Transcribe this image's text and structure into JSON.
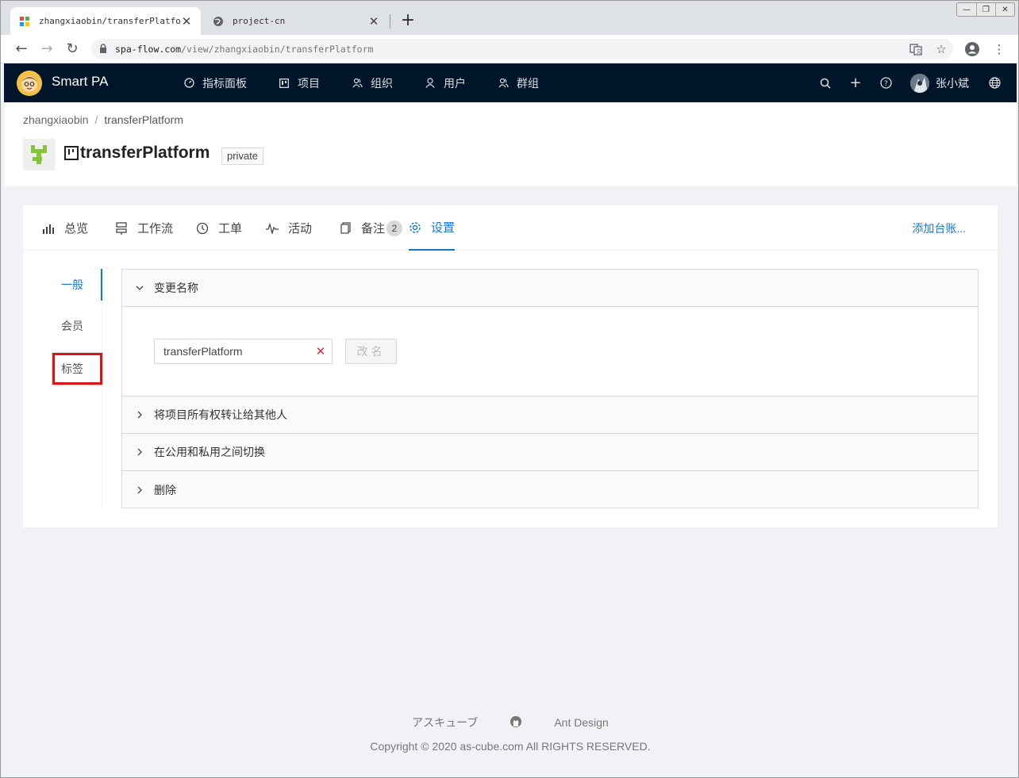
{
  "browser": {
    "tabs": [
      {
        "title": "zhangxiaobin/transferPlatform",
        "active": true
      },
      {
        "title": "project-cn",
        "active": false
      }
    ],
    "url_host": "spa-flow.com",
    "url_path": "/view/zhangxiaobin/transferPlatform"
  },
  "header": {
    "app_name": "Smart PA",
    "nav": [
      {
        "label": "指标面板",
        "icon": "dashboard-icon"
      },
      {
        "label": "项目",
        "icon": "project-icon"
      },
      {
        "label": "组织",
        "icon": "team-icon"
      },
      {
        "label": "用户",
        "icon": "user-icon"
      },
      {
        "label": "群组",
        "icon": "group-icon"
      }
    ],
    "user_name": "张小斌"
  },
  "page": {
    "breadcrumb": [
      "zhangxiaobin",
      "transferPlatform"
    ],
    "project_title": "transferPlatform",
    "visibility_tag": "private"
  },
  "tabs": [
    {
      "label": "总览",
      "icon": "bar-chart-icon"
    },
    {
      "label": "工作流",
      "icon": "workflow-icon"
    },
    {
      "label": "工单",
      "icon": "issue-icon"
    },
    {
      "label": "活动",
      "icon": "activity-icon"
    },
    {
      "label": "备注",
      "icon": "note-icon",
      "badge": "2"
    },
    {
      "label": "设置",
      "icon": "settings-icon",
      "active": true
    }
  ],
  "add_ledger": "添加台账...",
  "side_menu": [
    {
      "label": "一般",
      "active": true
    },
    {
      "label": "会员"
    },
    {
      "label": "标签",
      "highlighted": true
    }
  ],
  "panels": {
    "rename": {
      "title": "变更名称",
      "input_value": "transferPlatform",
      "button": "改名"
    },
    "transfer": {
      "title": "将项目所有权转让给其他人"
    },
    "visibility": {
      "title": "在公用和私用之间切换"
    },
    "delete": {
      "title": "删除"
    }
  },
  "footer": {
    "links": [
      "アスキューブ",
      "Ant Design"
    ],
    "copyright": "Copyright © 2020 as-cube.com All RIGHTS RESERVED."
  },
  "colors": {
    "header_bg": "#001529",
    "primary": "#1677cc",
    "highlight": "#d9141a"
  }
}
